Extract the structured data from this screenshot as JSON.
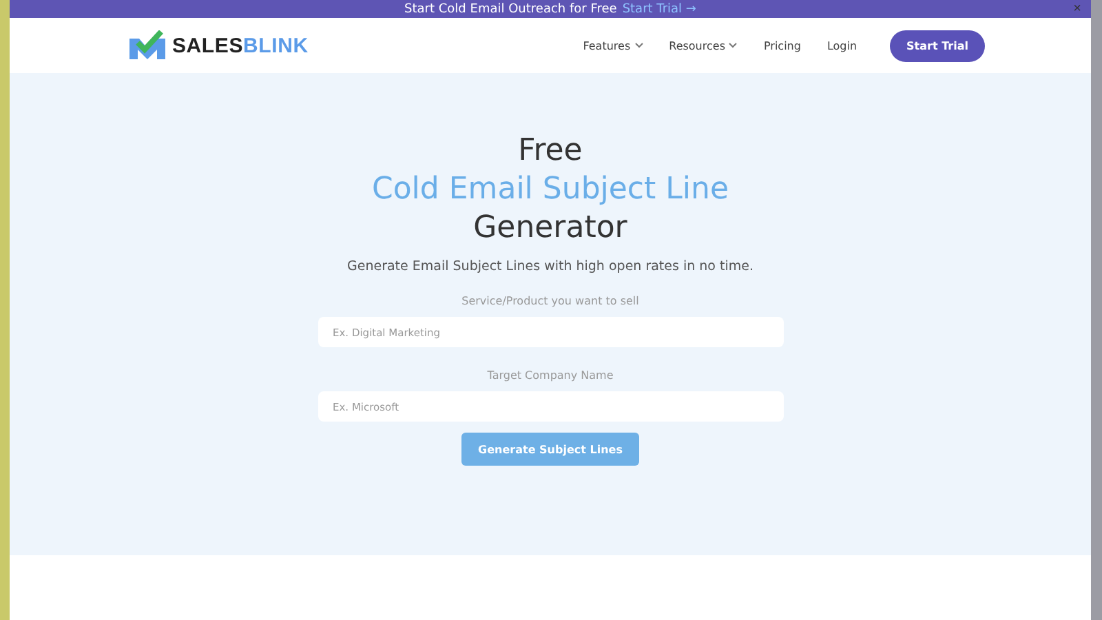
{
  "banner": {
    "text": "Start Cold Email Outreach for Free",
    "link": "Start Trial →",
    "close": "×"
  },
  "logo": {
    "primary": "SALES",
    "accent": "BLINK"
  },
  "nav": [
    {
      "label": "Features",
      "dropdown": true
    },
    {
      "label": "Resources",
      "dropdown": true
    },
    {
      "label": "Pricing",
      "dropdown": false
    },
    {
      "label": "Login",
      "dropdown": false
    }
  ],
  "cta": "Start Trial",
  "title": [
    {
      "text": "Free",
      "highlight": false
    },
    {
      "text": "Cold Email Subject Line",
      "highlight": true
    },
    {
      "text": "Generator",
      "highlight": false
    }
  ],
  "subtitle": "Generate Email Subject Lines with high open rates in no time.",
  "fields": [
    {
      "label": "Service/Product you want to sell",
      "placeholder": "Ex. Digital Marketing"
    },
    {
      "label": "Target Company Name",
      "placeholder": "Ex. Microsoft"
    }
  ],
  "submit": "Generate Subject Lines"
}
